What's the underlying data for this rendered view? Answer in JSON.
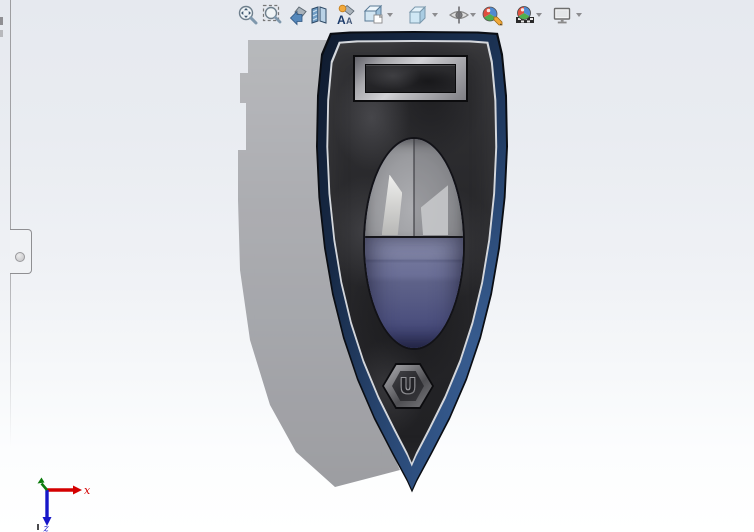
{
  "toolbar": {
    "items": [
      {
        "icon": "zoom-to-fit-icon",
        "has_dropdown": false
      },
      {
        "icon": "zoom-to-area-icon",
        "has_dropdown": false
      },
      {
        "icon": "previous-view-icon",
        "has_dropdown": false
      },
      {
        "icon": "section-view-icon",
        "has_dropdown": false
      },
      {
        "icon": "dynamic-annotation-views-icon",
        "has_dropdown": false
      },
      {
        "icon": "view-orientation-icon",
        "has_dropdown": true
      },
      {
        "icon": "display-style-icon",
        "has_dropdown": true
      },
      {
        "icon": "hide-show-items-icon",
        "has_dropdown": true
      },
      {
        "icon": "edit-appearance-icon",
        "has_dropdown": false
      },
      {
        "icon": "apply-scene-icon",
        "has_dropdown": true
      },
      {
        "icon": "view-settings-icon",
        "has_dropdown": true
      }
    ]
  },
  "viewport": {
    "triad": {
      "x_label": "x",
      "z_label": "z",
      "x_color": "#d40000",
      "z_color": "#1717c9",
      "y_color": "#0c7c0c"
    }
  },
  "model": {
    "emblem_letter": "U",
    "colors": {
      "hull_accent_navy": "#2b4c7c",
      "deck_charcoal": "#232326",
      "canopy_glass_gray": "#9b9ca0",
      "canopy_tint_blue": "#5e6289",
      "trim_silver": "#d4d7dc",
      "shadow_gray": "#a2a3a7"
    }
  }
}
